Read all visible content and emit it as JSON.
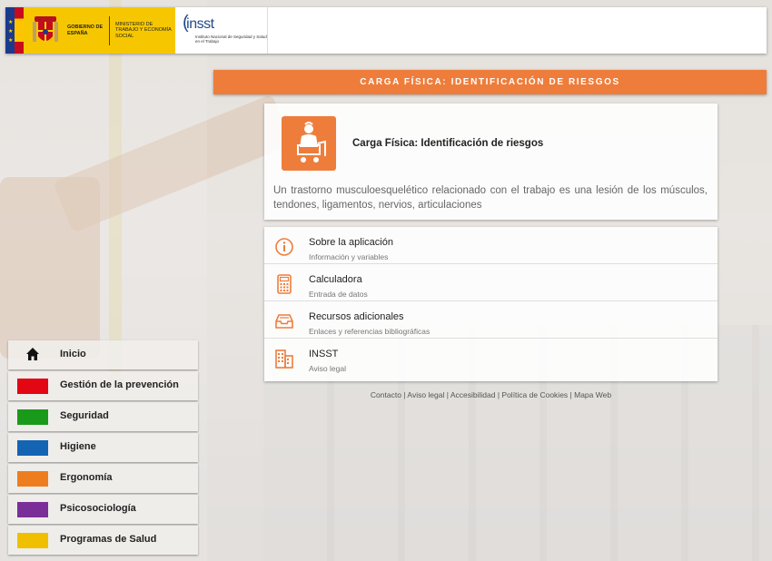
{
  "header": {
    "gobierno": "GOBIERNO DE ESPAÑA",
    "ministerio": "MINISTERIO DE TRABAJO Y ECONOMÍA SOCIAL",
    "insst_logo": "insst",
    "insst_tagline": "Instituto Nacional de Seguridad y Salud en el Trabajo"
  },
  "title_bar": "CARGA FÍSICA: IDENTIFICACIÓN DE RIESGOS",
  "intro": {
    "icon": "worker-lifting-icon",
    "title": "Carga Física: Identificación de riesgos",
    "description": "Un trastorno musculoesquelético relacionado con el trabajo es una lesión de los músculos, tendones, ligamentos, nervios, articulaciones"
  },
  "menu": [
    {
      "icon": "info-icon",
      "title": "Sobre la aplicación",
      "subtitle": "Información y variables"
    },
    {
      "icon": "calculator-icon",
      "title": "Calculadora",
      "subtitle": "Entrada de datos"
    },
    {
      "icon": "inbox-icon",
      "title": "Recursos adicionales",
      "subtitle": "Enlaces y referencias bibliográficas"
    },
    {
      "icon": "building-icon",
      "title": "INSST",
      "subtitle": "Aviso legal"
    }
  ],
  "footer": {
    "links": [
      "Contacto",
      "Aviso legal",
      "Accesibilidad",
      "Política de Cookies",
      "Mapa Web"
    ],
    "separator": " | "
  },
  "nav": [
    {
      "label": "Inicio",
      "icon": "home-icon",
      "color": ""
    },
    {
      "label": "Gestión de la prevención",
      "color": "#e30613"
    },
    {
      "label": "Seguridad",
      "color": "#1a9a1a"
    },
    {
      "label": "Higiene",
      "color": "#1464b4"
    },
    {
      "label": "Ergonomía",
      "color": "#ee7d1f"
    },
    {
      "label": "Psicosociología",
      "color": "#7a2f98"
    },
    {
      "label": "Programas de Salud",
      "color": "#f0c000"
    }
  ],
  "colors": {
    "accent": "#ee7d3c"
  }
}
